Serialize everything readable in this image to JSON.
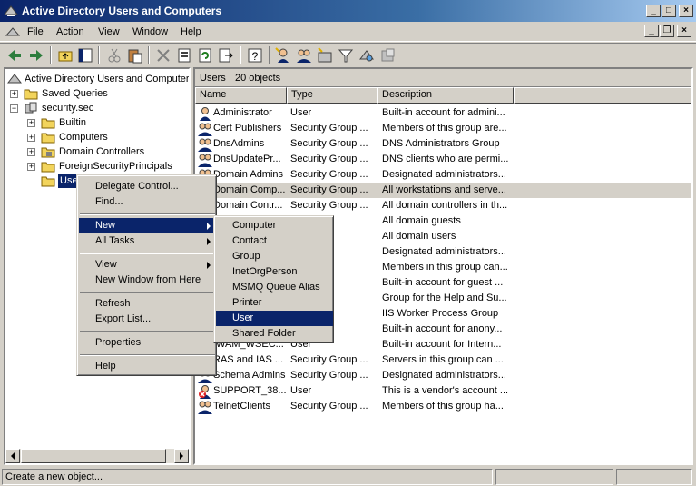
{
  "window": {
    "title": "Active Directory Users and Computers",
    "caption_buttons": [
      "minimize",
      "maximize",
      "close"
    ]
  },
  "menubar": {
    "items": [
      {
        "label": "File"
      },
      {
        "label": "Action"
      },
      {
        "label": "View"
      },
      {
        "label": "Window"
      },
      {
        "label": "Help"
      }
    ]
  },
  "toolbar": {
    "buttons": [
      "back-icon",
      "forward-icon",
      "up-folder-icon",
      "show-tree-icon",
      "cut-icon",
      "paste-icon",
      "delete-icon",
      "properties-icon",
      "refresh-icon",
      "export-icon",
      "help-icon",
      "new-user-icon",
      "new-group-icon",
      "new-ou-icon",
      "filter-icon",
      "find-icon",
      "add-to-group-icon"
    ]
  },
  "tree": {
    "root": "Active Directory Users and Computers",
    "saved_queries": "Saved Queries",
    "domain": "security.sec",
    "children": [
      {
        "label": "Builtin"
      },
      {
        "label": "Computers"
      },
      {
        "label": "Domain Controllers"
      },
      {
        "label": "ForeignSecurityPrincipals"
      },
      {
        "label": "Users"
      }
    ]
  },
  "list": {
    "header_title": "Users",
    "header_count": "20 objects",
    "columns": [
      "Name",
      "Type",
      "Description"
    ],
    "rows": [
      {
        "name": "Administrator",
        "type": "User",
        "desc": "Built-in account for admini..."
      },
      {
        "name": "Cert Publishers",
        "type": "Security Group ...",
        "desc": "Members of this group are..."
      },
      {
        "name": "DnsAdmins",
        "type": "Security Group ...",
        "desc": "DNS Administrators Group"
      },
      {
        "name": "DnsUpdatePr...",
        "type": "Security Group ...",
        "desc": "DNS clients who are permi..."
      },
      {
        "name": "Domain Admins",
        "type": "Security Group ...",
        "desc": "Designated administrators..."
      },
      {
        "name": "Domain Comp...",
        "type": "Security Group ...",
        "desc": "All workstations and serve..."
      },
      {
        "name": "Domain Contr...",
        "type": "Security Group ...",
        "desc": "All domain controllers in th..."
      },
      {
        "name": "",
        "type": "roup ...",
        "desc": "All domain guests"
      },
      {
        "name": "",
        "type": "roup ...",
        "desc": "All domain users"
      },
      {
        "name": "",
        "type": "roup ...",
        "desc": "Designated administrators..."
      },
      {
        "name": "",
        "type": "roup ...",
        "desc": "Members in this group can..."
      },
      {
        "name": "",
        "type": "",
        "desc": "Built-in account for guest ..."
      },
      {
        "name": "",
        "type": "roup ...",
        "desc": "Group for the Help and Su..."
      },
      {
        "name": "",
        "type": "roup ...",
        "desc": "IIS Worker Process Group"
      },
      {
        "name": "",
        "type": "",
        "desc": "Built-in account for anony..."
      },
      {
        "name": "IWAM_WSEC...",
        "type": "User",
        "desc": "Built-in account for Intern..."
      },
      {
        "name": "RAS and IAS ...",
        "type": "Security Group ...",
        "desc": "Servers in this group can ..."
      },
      {
        "name": "Schema Admins",
        "type": "Security Group ...",
        "desc": "Designated administrators..."
      },
      {
        "name": "SUPPORT_38...",
        "type": "User",
        "desc": "This is a vendor's account ..."
      },
      {
        "name": "TelnetClients",
        "type": "Security Group ...",
        "desc": "Members of this group ha..."
      }
    ]
  },
  "context_menu": {
    "items": [
      {
        "label": "Delegate Control..."
      },
      {
        "label": "Find..."
      },
      {
        "label": "New"
      },
      {
        "label": "All Tasks"
      },
      {
        "label": "View"
      },
      {
        "label": "New Window from Here"
      },
      {
        "label": "Refresh"
      },
      {
        "label": "Export List..."
      },
      {
        "label": "Properties"
      },
      {
        "label": "Help"
      }
    ]
  },
  "submenu": {
    "items": [
      {
        "label": "Computer"
      },
      {
        "label": "Contact"
      },
      {
        "label": "Group"
      },
      {
        "label": "InetOrgPerson"
      },
      {
        "label": "MSMQ Queue Alias"
      },
      {
        "label": "Printer"
      },
      {
        "label": "User"
      },
      {
        "label": "Shared Folder"
      }
    ]
  },
  "statusbar": {
    "text": "Create a new object..."
  },
  "colors": {
    "selection": "#0a246a",
    "title_start": "#0a246a",
    "face": "#d4d0c8"
  }
}
